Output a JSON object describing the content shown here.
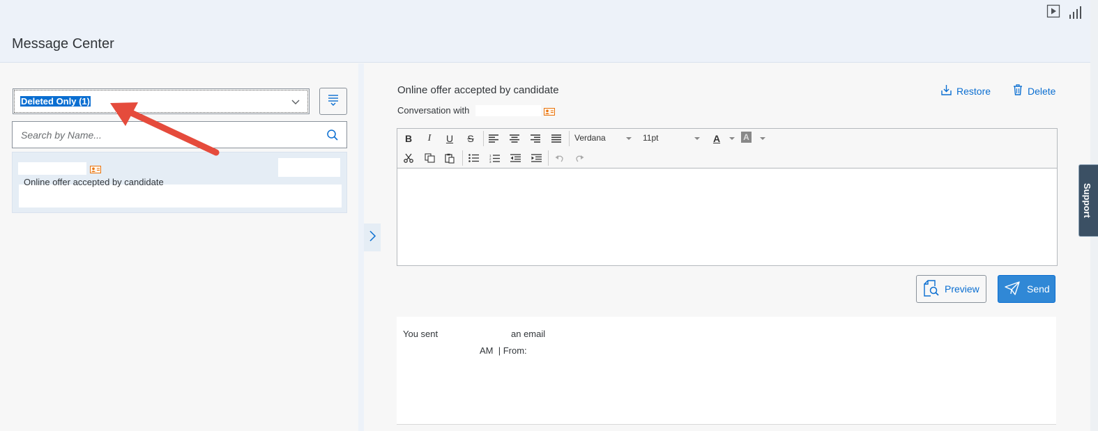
{
  "header": {
    "title": "Message Center",
    "icons": [
      "play-icon",
      "bar-chart-icon"
    ]
  },
  "sidebar": {
    "filter": {
      "selected": "Deleted Only (1)",
      "menu_icon": "list-filter-icon"
    },
    "search": {
      "placeholder": "Search by Name...",
      "value": ""
    },
    "conversations": [
      {
        "subject": "Online offer accepted by candidate",
        "icon": "contact-card-icon"
      }
    ]
  },
  "message": {
    "title": "Online offer accepted by candidate",
    "conversation_with_label": "Conversation with",
    "actions": {
      "restore": "Restore",
      "delete": "Delete"
    },
    "editor": {
      "font": "Verdana",
      "size": "11pt",
      "text_color_label": "A",
      "bg_color_label": "A"
    },
    "buttons": {
      "preview": "Preview",
      "send": "Send"
    },
    "history": {
      "sent_prefix": "You sent",
      "sent_suffix": "an email",
      "meta": "AM  | From:"
    }
  },
  "support_tab": "Support",
  "colors": {
    "accent": "#0a6ed1",
    "send_bg": "#3088d6",
    "annotation_arrow": "#e54b3c",
    "header_bg": "#edf2f9",
    "contact_icon": "#e9730c"
  }
}
